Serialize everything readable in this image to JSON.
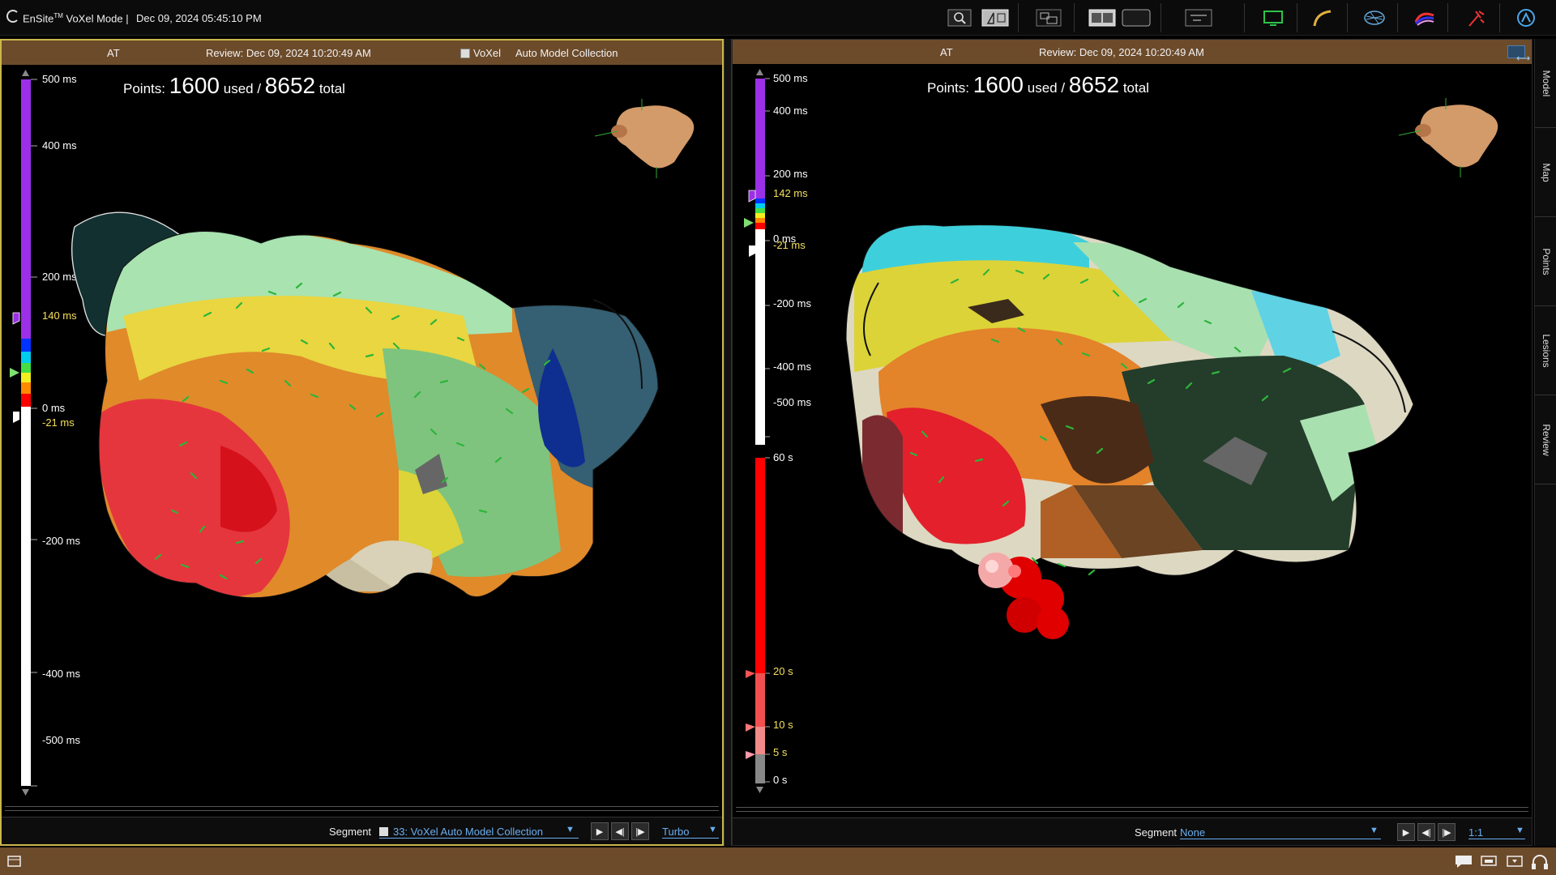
{
  "topbar": {
    "app_title": "EnSite",
    "app_title_tm": "TM",
    "app_title_rest": " VoXel Mode |",
    "datetime": "Dec 09, 2024 05:45:10 PM",
    "buttons": [
      "zoom-icon",
      "select-region-icon",
      "snapshot-icon",
      "dual-view-icon",
      "single-view-icon",
      "tools-icon",
      "monitor-icon",
      "catheter-icon",
      "mesh-icon",
      "map-color-icon",
      "ablation-icon",
      "navigation-icon"
    ]
  },
  "panel_left": {
    "header": {
      "map_type": "AT",
      "review": "Review: Dec 09, 2024 10:20:49 AM",
      "voxel": "VoXel",
      "collection": "Auto Model Collection"
    },
    "points": {
      "label": "Points:",
      "used": "1600",
      "used_label": "used /",
      "total": "8652",
      "total_label": "total"
    },
    "scale": {
      "max": "500 ms",
      "t400": "400 ms",
      "t200": "200 ms",
      "upper": "140 ms",
      "zero": "0 ms",
      "lower": "-21 ms",
      "tm200": "-200 ms",
      "tm400": "-400 ms",
      "min": "-500 ms"
    },
    "footer": {
      "segment_label": "Segment",
      "segment_value": "33: VoXel Auto Model Collection",
      "speed": "Turbo"
    }
  },
  "panel_right": {
    "header": {
      "map_type": "AT",
      "review": "Review: Dec 09, 2024 10:20:49 AM"
    },
    "points": {
      "label": "Points:",
      "used": "1600",
      "used_label": "used /",
      "total": "8652",
      "total_label": "total"
    },
    "scale": {
      "max": "500 ms",
      "t400": "400 ms",
      "t200": "200 ms",
      "upper": "142 ms",
      "zero": "0 ms",
      "lower": "-21 ms",
      "tm200": "-200 ms",
      "tm400": "-400 ms",
      "min": "-500 ms"
    },
    "time_scale": {
      "t60": "60 s",
      "t20": "20 s",
      "t10": "10 s",
      "t5": "5 s",
      "t0": "0 s"
    },
    "footer": {
      "segment_label": "Segment",
      "segment_value": "None",
      "speed": "1:1"
    }
  },
  "side_tabs": [
    "Model",
    "Map",
    "Points",
    "Lesions",
    "Review"
  ],
  "colors": {
    "header_brown": "#6c4b2b",
    "active_border": "#c9b74a",
    "link_blue": "#6aaef0",
    "scale_purple": "#9b30e8",
    "lesion_red": "#e00000"
  }
}
